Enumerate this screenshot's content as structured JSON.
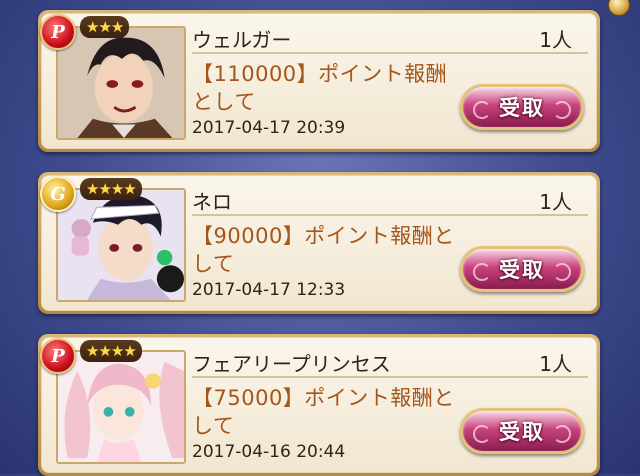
{
  "colors": {
    "background": "#4a5898",
    "card": "#f7efdf",
    "reward_text": "#a4561b",
    "button": "#c9437e"
  },
  "entries": [
    {
      "rank": "P",
      "stars": "★★★",
      "name": "ウェルガー",
      "count": "1人",
      "reward_line1": "【110000】ポイント報酬",
      "reward_line2": "として",
      "timestamp": "2017-04-17 20:39",
      "button_label": "受取"
    },
    {
      "rank": "G",
      "stars": "★★★★",
      "name": "ネロ",
      "count": "1人",
      "reward_line1": "【90000】ポイント報酬と",
      "reward_line2": "して",
      "timestamp": "2017-04-17 12:33",
      "button_label": "受取"
    },
    {
      "rank": "P",
      "stars": "★★★★",
      "name": "フェアリープリンセス",
      "count": "1人",
      "reward_line1": "【75000】ポイント報酬と",
      "reward_line2": "して",
      "timestamp": "2017-04-16 20:44",
      "button_label": "受取"
    }
  ]
}
